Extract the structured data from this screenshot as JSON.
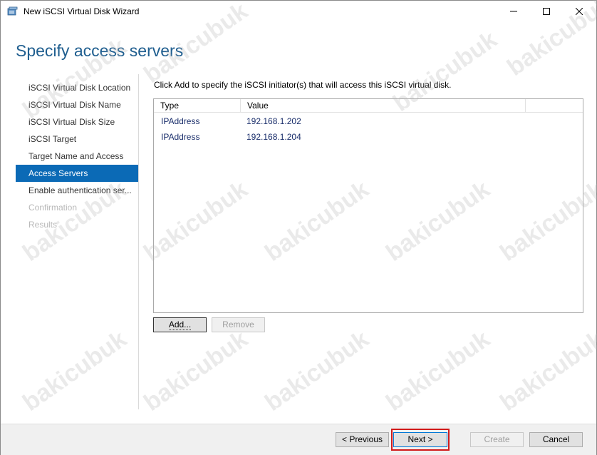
{
  "window": {
    "title": "New iSCSI Virtual Disk Wizard",
    "icons": {
      "app": "disk-wizard-icon",
      "minimize": "minimize-icon",
      "maximize": "maximize-icon",
      "close": "close-icon"
    }
  },
  "page": {
    "heading": "Specify access servers"
  },
  "nav": {
    "items": [
      {
        "label": "iSCSI Virtual Disk Location",
        "state": "completed"
      },
      {
        "label": "iSCSI Virtual Disk Name",
        "state": "completed"
      },
      {
        "label": "iSCSI Virtual Disk Size",
        "state": "completed"
      },
      {
        "label": "iSCSI Target",
        "state": "completed"
      },
      {
        "label": "Target Name and Access",
        "state": "completed"
      },
      {
        "label": "Access Servers",
        "state": "active"
      },
      {
        "label": "Enable authentication ser...",
        "state": "pending"
      },
      {
        "label": "Confirmation",
        "state": "disabled"
      },
      {
        "label": "Results",
        "state": "disabled"
      }
    ]
  },
  "main": {
    "instruction": "Click Add to specify the iSCSI initiator(s) that will access this iSCSI virtual disk.",
    "table": {
      "columns": [
        "Type",
        "Value"
      ],
      "rows": [
        {
          "type": "IPAddress",
          "value": "192.168.1.202"
        },
        {
          "type": "IPAddress",
          "value": "192.168.1.204"
        }
      ]
    },
    "add_label": "Add...",
    "remove_label": "Remove"
  },
  "footer": {
    "previous_label": "< Previous",
    "next_label": "Next >",
    "create_label": "Create",
    "cancel_label": "Cancel"
  },
  "watermark": "bakicubuk",
  "colors": {
    "accent": "#0b6ab6",
    "heading": "#1f5e8f",
    "highlight": "#d11a1a"
  }
}
